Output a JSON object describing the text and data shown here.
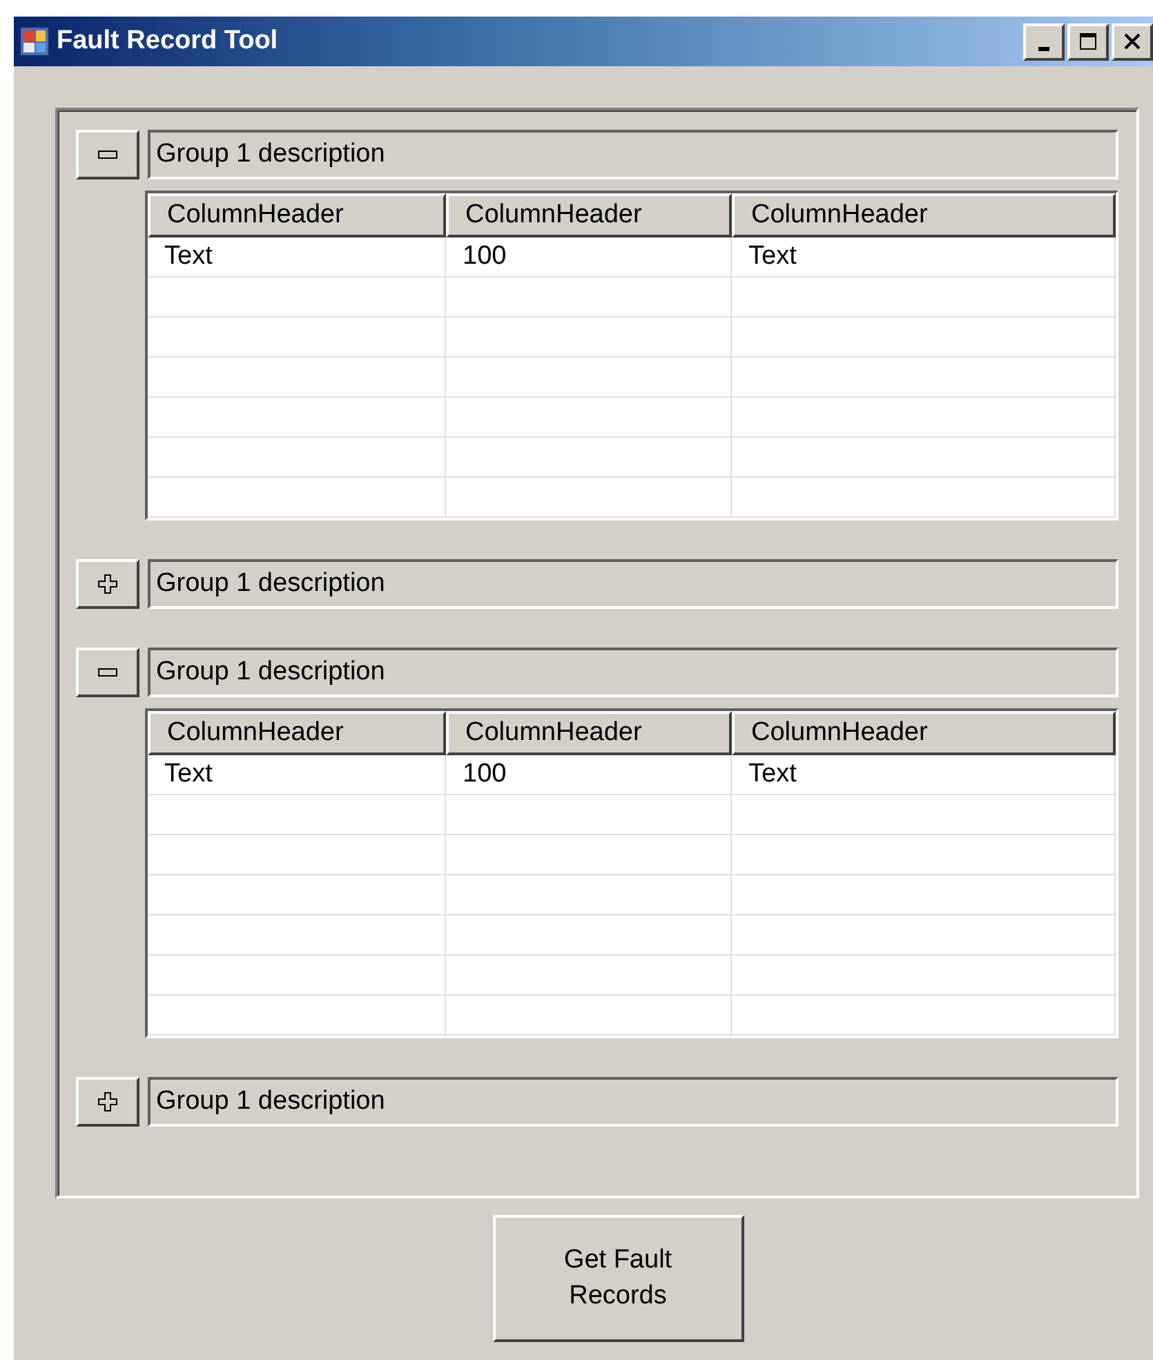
{
  "window": {
    "title": "Fault Record Tool"
  },
  "groups": [
    {
      "description": "Group 1 description",
      "expanded": true,
      "table": {
        "columns": [
          "ColumnHeader",
          "ColumnHeader",
          "ColumnHeader"
        ],
        "rows": [
          [
            "Text",
            "100",
            "Text"
          ]
        ]
      }
    },
    {
      "description": "Group 1 description",
      "expanded": false
    },
    {
      "description": "Group 1 description",
      "expanded": true,
      "table": {
        "columns": [
          "ColumnHeader",
          "ColumnHeader",
          "ColumnHeader"
        ],
        "rows": [
          [
            "Text",
            "100",
            "Text"
          ]
        ]
      }
    },
    {
      "description": "Group 1 description",
      "expanded": false
    }
  ],
  "buttons": [
    "Get Fault\nRecords"
  ]
}
